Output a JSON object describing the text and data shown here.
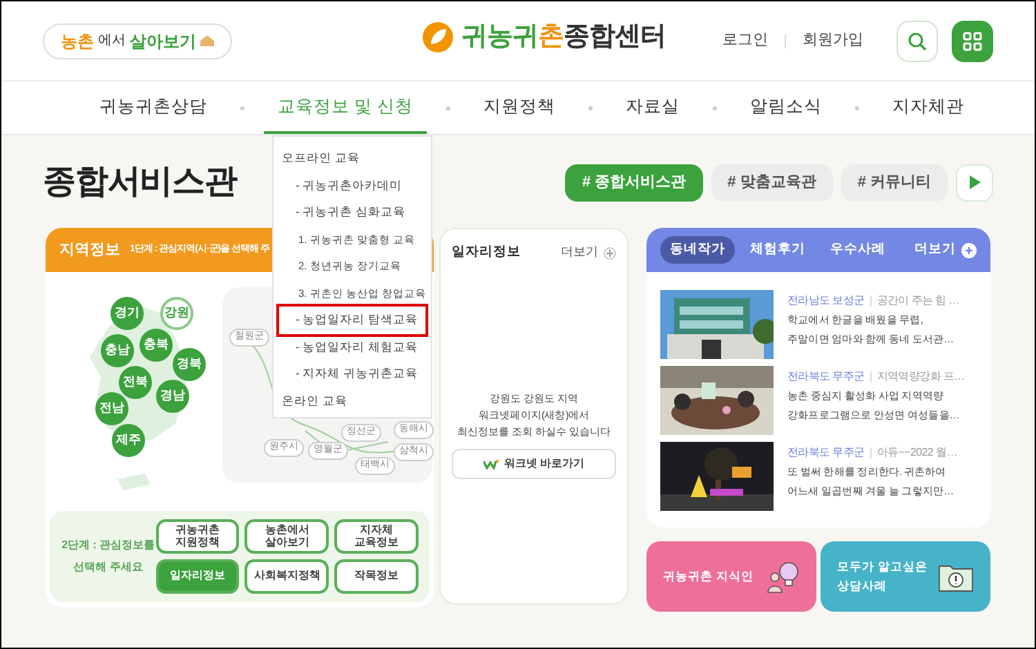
{
  "header": {
    "promo_button": [
      {
        "text": "농촌",
        "color": "#f0930f"
      },
      {
        "text": "에서",
        "color": "#333333"
      },
      {
        "text": "살아보기",
        "color": "#3ca23d"
      }
    ],
    "logo": [
      {
        "text": "귀농귀",
        "color": "#3ca23d"
      },
      {
        "text": "촌",
        "color": "#f0930f"
      },
      {
        "text": "종합센터",
        "color": "#333333"
      }
    ],
    "links": [
      "로그인",
      "회원가입"
    ]
  },
  "nav": [
    {
      "label": "귀농귀촌상담",
      "selected": false
    },
    {
      "label": "교육정보 및 신청",
      "selected": true
    },
    {
      "label": "지원정책",
      "selected": false
    },
    {
      "label": "자료실",
      "selected": false
    },
    {
      "label": "알림소식",
      "selected": false
    },
    {
      "label": "지자체관",
      "selected": false
    }
  ],
  "dropdown": [
    {
      "label": "오프라인 교육",
      "kind": "heading",
      "highlighted": false
    },
    {
      "label": "- 귀농귀촌아카데미",
      "kind": "sub",
      "highlighted": false
    },
    {
      "label": "- 귀농귀촌 심화교육",
      "kind": "sub",
      "highlighted": false
    },
    {
      "label": "1. 귀농귀촌 맞춤형 교육",
      "kind": "numbered",
      "highlighted": false
    },
    {
      "label": "2. 청년귀농 장기교육",
      "kind": "numbered",
      "highlighted": false
    },
    {
      "label": "3. 귀촌인 농산업 창업교육",
      "kind": "numbered",
      "highlighted": false
    },
    {
      "label": "- 농업일자리 탐색교육",
      "kind": "sub",
      "highlighted": true
    },
    {
      "label": "- 농업일자리 체험교육",
      "kind": "sub",
      "highlighted": false
    },
    {
      "label": "- 지자체 귀농귀촌교육",
      "kind": "sub",
      "highlighted": false
    },
    {
      "label": "온라인 교육",
      "kind": "heading",
      "highlighted": false
    }
  ],
  "page_title": "종합서비스관",
  "hashtags": [
    {
      "label": "# 종합서비스관",
      "selected": true
    },
    {
      "label": "# 맞춤교육관",
      "selected": false
    },
    {
      "label": "# 커뮤니티",
      "selected": false
    }
  ],
  "region_card": {
    "title": "지역정보",
    "instruction": "1단계 : 관심지역(시·군)을 선택해 주",
    "provinces": [
      {
        "label": "경기",
        "selected": false
      },
      {
        "label": "강원",
        "selected": true
      },
      {
        "label": "충남",
        "selected": false
      },
      {
        "label": "충북",
        "selected": false
      },
      {
        "label": "경북",
        "selected": false
      },
      {
        "label": "전북",
        "selected": false
      },
      {
        "label": "경남",
        "selected": false
      },
      {
        "label": "전남",
        "selected": false
      },
      {
        "label": "제주",
        "selected": false
      }
    ],
    "map_labels": [
      "철원군",
      "정선군",
      "동해시",
      "원주시",
      "영월군",
      "삼척시",
      "태백시"
    ],
    "step2": {
      "instruction": "2단계 : 관심정보를 선택해 주세요",
      "options": [
        {
          "label": "귀농귀촌 지원정책",
          "selected": false
        },
        {
          "label": "농촌에서 살아보기",
          "selected": false
        },
        {
          "label": "지자체 교육정보",
          "selected": false
        },
        {
          "label": "일자리정보",
          "selected": true
        },
        {
          "label": "사회복지정책",
          "selected": false
        },
        {
          "label": "작목정보",
          "selected": false
        }
      ]
    }
  },
  "job_card": {
    "title": "일자리정보",
    "more": "더보기",
    "message": [
      "강원도 강원도 지역",
      "워크넷페이지(새창)에서",
      "최신정보를 조회 하실수 있습니다"
    ],
    "button": "워크넷 바로가기"
  },
  "stories": {
    "tabs": [
      {
        "label": "동네작가",
        "selected": true
      },
      {
        "label": "체험후기",
        "selected": false
      },
      {
        "label": "우수사례",
        "selected": false
      }
    ],
    "more": "더보기",
    "items": [
      {
        "region": "전라남도 보성군",
        "subtitle": "공간이 주는 힘 …",
        "excerpt": [
          "학교에서 한글을 배웠을 무렵,",
          "주말이면 엄마와 함께 동네 도서관…"
        ],
        "picture": {
          "kind": "picture"
        }
      },
      {
        "region": "전라북도 무주군",
        "subtitle": "지역역량강화 프…",
        "excerpt": [
          "농촌 중심지 활성화 사업 지역역량",
          "강화프로그램으로 안성면 여성들을…"
        ],
        "picture": {
          "kind": "picture"
        }
      },
      {
        "region": "전라북도 무주군",
        "subtitle": "아듀~~2022 월…",
        "excerpt": [
          "또 벌써 한해를 정리한다. 귀촌하여",
          "어느새 일곱번째 겨울 늘 그렇지만…"
        ],
        "picture": {
          "kind": "picture"
        }
      }
    ]
  },
  "banners": [
    {
      "label": "귀농귀촌 지식인",
      "color": "#ee6f9a",
      "kind": "bulb"
    },
    {
      "label": "모두가 알고싶은 상담사례",
      "color": "#46b3c9",
      "kind": "folder"
    }
  ]
}
